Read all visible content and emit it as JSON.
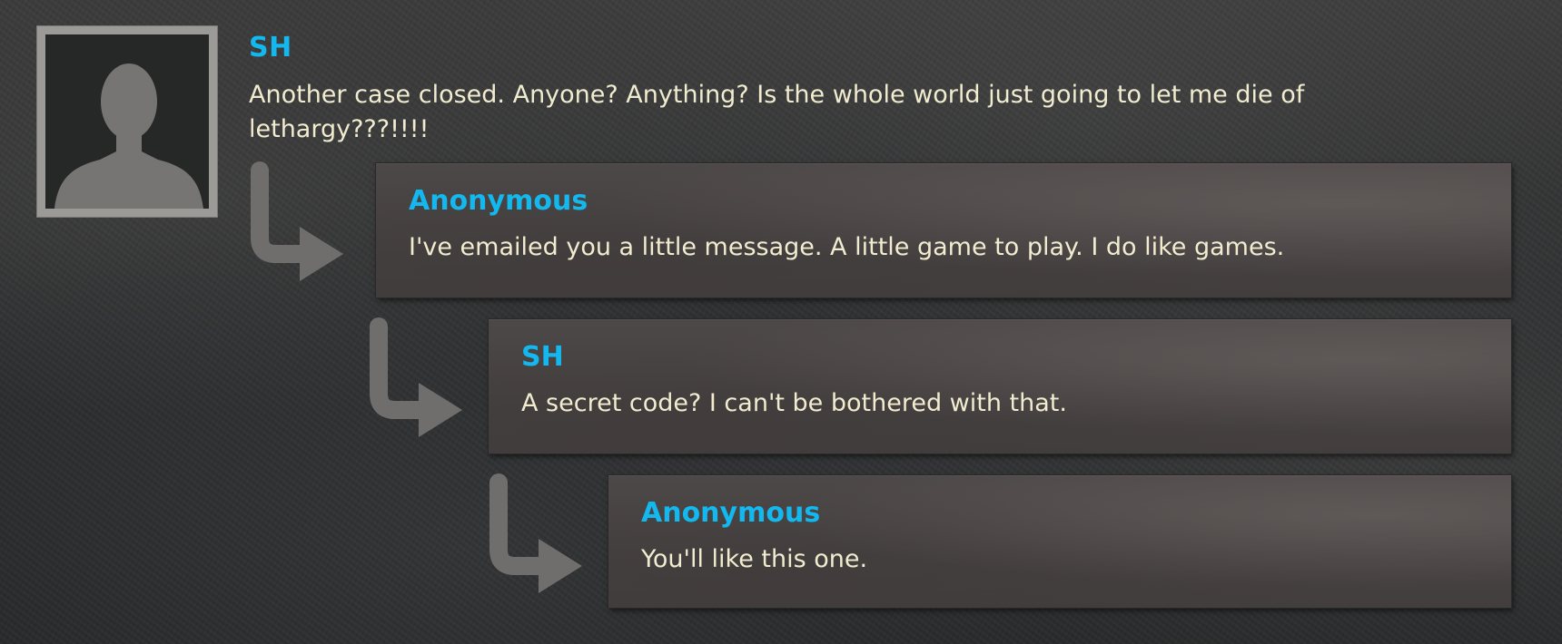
{
  "thread": {
    "root": {
      "author": "SH",
      "text": "Another case closed. Anyone? Anything? Is the whole world just going to let me die of lethargy???!!!!",
      "avatar_icon": "person-silhouette-icon"
    },
    "replies": [
      {
        "author": "Anonymous",
        "text": "I've emailed you a little message. A little game to play. I do like games."
      },
      {
        "author": "SH",
        "text": "A secret code? I can't be bothered with that."
      },
      {
        "author": "Anonymous",
        "text": "You'll like this one."
      }
    ],
    "reply_icon": "reply-arrow-icon"
  },
  "colors": {
    "author": "#13b8ef",
    "body_text": "#f1eccf",
    "reply_box": "#4a4545",
    "avatar_frame": "#9c9a97"
  }
}
